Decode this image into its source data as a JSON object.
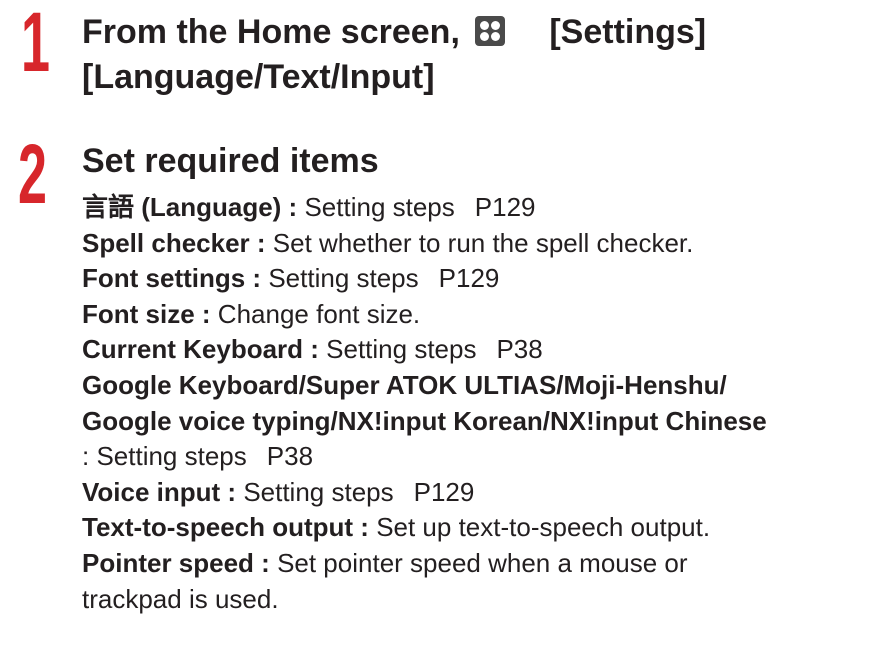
{
  "step1": {
    "number": "1",
    "lead": "From the Home screen,",
    "settings": "[Settings]",
    "language": "[Language/Text/Input]",
    "icon": "apps-icon"
  },
  "step2": {
    "number": "2",
    "title": "Set required items",
    "items": [
      {
        "term": "言語 (Language) :",
        "desc": "Setting steps",
        "ref": "P129"
      },
      {
        "term": "Spell checker :",
        "desc": "Set whether to run the spell checker."
      },
      {
        "term": "Font settings :",
        "desc": "Setting steps",
        "ref": "P129"
      },
      {
        "term": "Font size :",
        "desc": "Change font size."
      },
      {
        "term": "Current Keyboard :",
        "desc": "Setting steps",
        "ref": "P38"
      },
      {
        "term_line1": "Google Keyboard/Super ATOK ULTIAS/Moji-Henshu/",
        "term_line2": "Google voice typing/NX!input Korean/NX!input Chinese",
        "desc": ": Setting steps",
        "ref": "P38"
      },
      {
        "term": "Voice input :",
        "desc": "Setting steps",
        "ref": "P129"
      },
      {
        "term": "Text-to-speech output :",
        "desc": "Set up text-to-speech output."
      },
      {
        "term": "Pointer speed :",
        "desc_line1": "Set pointer speed when a mouse or",
        "desc_line2": "trackpad is used."
      }
    ]
  }
}
